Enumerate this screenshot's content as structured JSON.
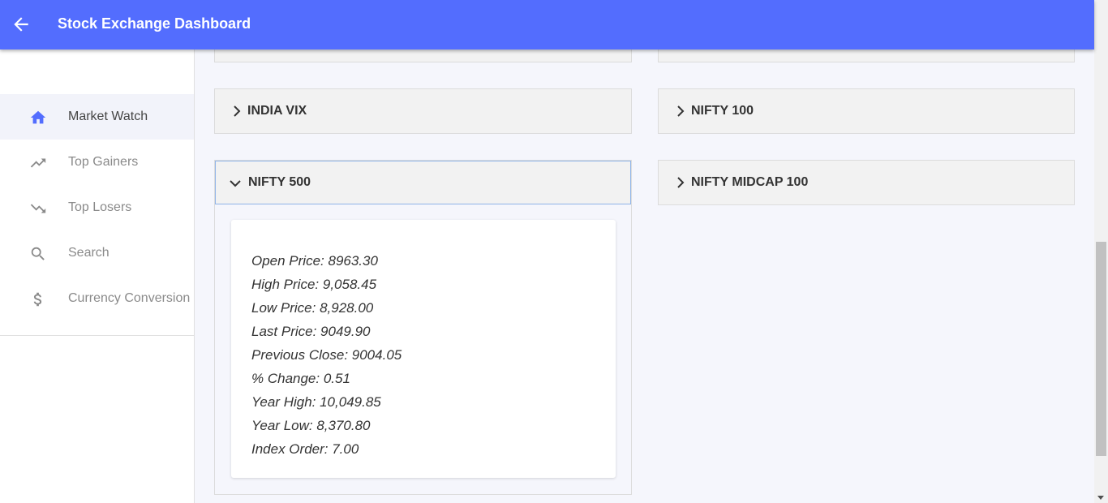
{
  "appbar": {
    "title": "Stock Exchange Dashboard",
    "back_icon": "arrow-back-icon",
    "color": "#536dfe"
  },
  "sidebar": {
    "items": [
      {
        "label": "Market Watch",
        "icon": "home-icon",
        "active": true
      },
      {
        "label": "Top Gainers",
        "icon": "trending-up-icon"
      },
      {
        "label": "Top Losers",
        "icon": "trending-down-icon"
      },
      {
        "label": "Search",
        "icon": "search-icon"
      },
      {
        "label": "Currency Conversion",
        "icon": "dollar-icon"
      }
    ]
  },
  "panels": [
    {
      "title": "INDIA VIX",
      "expanded": false
    },
    {
      "title": "NIFTY 100",
      "expanded": false
    },
    {
      "title": "NIFTY 500",
      "expanded": true
    },
    {
      "title": "NIFTY MIDCAP 100",
      "expanded": false
    }
  ],
  "details": [
    "Open Price: 8963.30",
    "High Price: 9,058.45",
    "Low Price: 8,928.00",
    "Last Price: 9049.90",
    "Previous Close: 9004.05",
    "% Change: 0.51",
    "Year High: 10,049.85",
    "Year Low: 8,370.80",
    "Index Order: 7.00"
  ]
}
